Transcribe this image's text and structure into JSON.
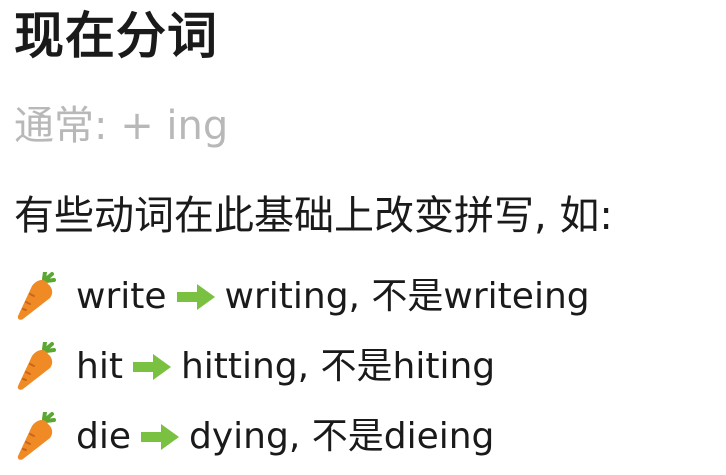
{
  "title": "现在分词",
  "subtitle": "通常: + ing",
  "intro": "有些动词在此基础上改变拼写, 如:",
  "examples": [
    {
      "base": "write",
      "result": "writing, 不是writeing"
    },
    {
      "base": "hit",
      "result": "hitting, 不是hiting"
    },
    {
      "base": "die",
      "result": "dying, 不是dieing"
    }
  ],
  "icons": {
    "bullet": "carrot-icon",
    "separator": "right-arrow-icon"
  },
  "colors": {
    "subtitle": "#b8b8b8",
    "arrow": "#7ac142",
    "carrot": "#f08a24",
    "carrot_leaf": "#5aa832"
  }
}
